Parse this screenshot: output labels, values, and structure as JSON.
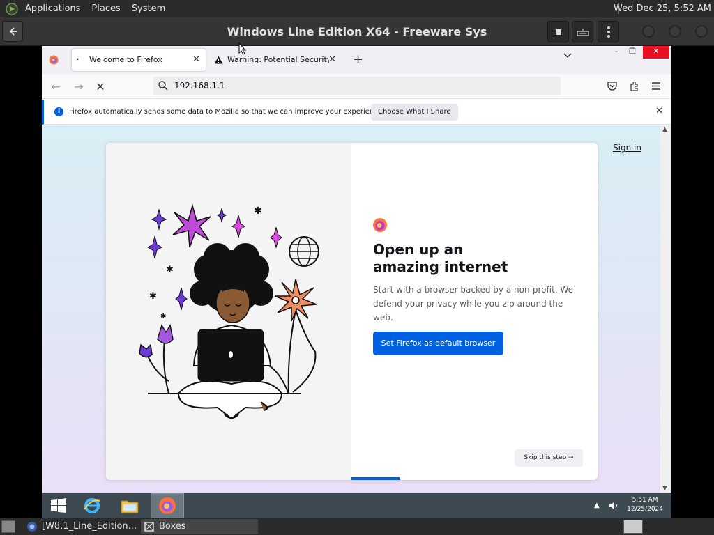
{
  "gnome_panel": {
    "menus": [
      "Applications",
      "Places",
      "System"
    ],
    "clock": "Wed Dec 25,  5:52 AM"
  },
  "boxes_header": {
    "title": "Windows Line Edition X64 - Freeware Sys"
  },
  "browser": {
    "tabs": [
      {
        "label": "Welcome to Firefox",
        "active": true
      },
      {
        "label": "Warning: Potential Security Risk",
        "active": false
      }
    ],
    "url": "192.168.1.1",
    "notification": {
      "message": "Firefox automatically sends some data to Mozilla so that we can improve your experience.",
      "button": "Choose What I Share"
    },
    "page": {
      "sign_in": "Sign in",
      "headline": "Open up an amazing internet",
      "subtext": "Start with a browser backed by a non-profit. We defend your privacy while you zip around the web.",
      "primary_button": "Set Firefox as default browser",
      "skip_button": "Skip this step →"
    }
  },
  "windows_taskbar": {
    "time": "5:51 AM",
    "date": "12/25/2024"
  },
  "host_bottom_panel": {
    "items": [
      "[W8.1_Line_Edition...",
      "Boxes"
    ]
  },
  "colors": {
    "accent_blue": "#0061e0",
    "taskbar": "#3d4a52",
    "gnome_panel": "#2b2b2b"
  }
}
